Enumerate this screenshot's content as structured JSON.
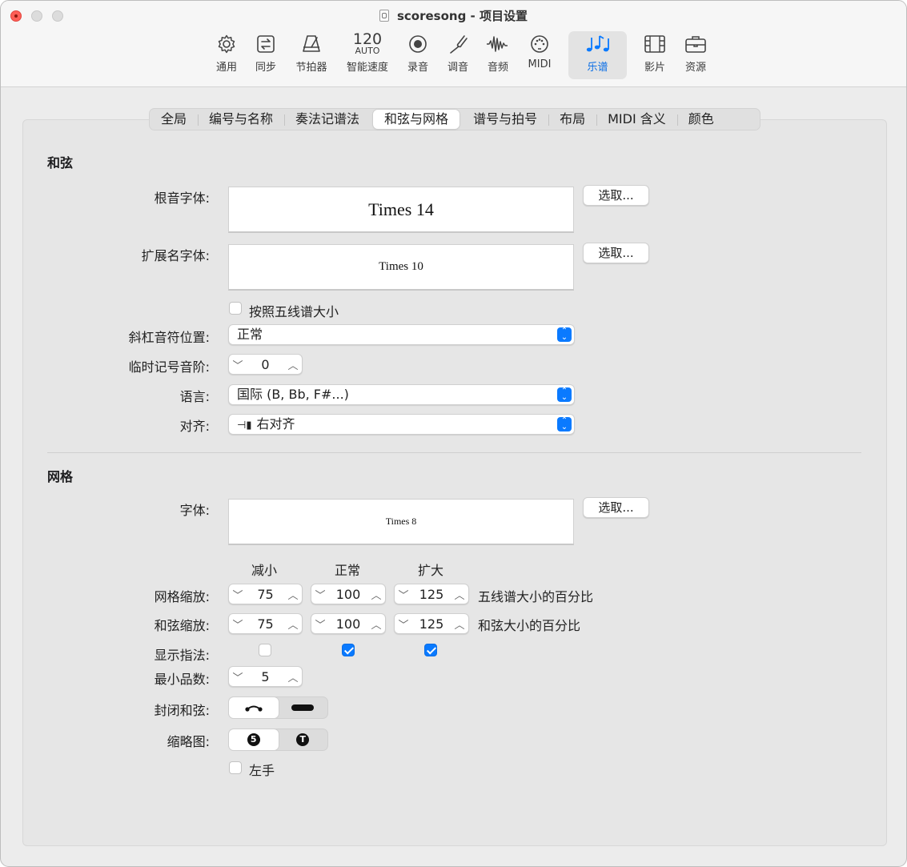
{
  "window": {
    "title": "scoresong - 项目设置"
  },
  "toolbar": {
    "items": [
      {
        "label": "通用",
        "icon": "gear-icon"
      },
      {
        "label": "同步",
        "icon": "sync-icon"
      },
      {
        "label": "节拍器",
        "icon": "metronome-icon"
      },
      {
        "label": "智能速度",
        "icon": "tempo-icon",
        "bpm": "120",
        "auto": "AUTO"
      },
      {
        "label": "录音",
        "icon": "record-icon"
      },
      {
        "label": "调音",
        "icon": "tuning-fork-icon"
      },
      {
        "label": "音频",
        "icon": "waveform-icon"
      },
      {
        "label": "MIDI",
        "icon": "midi-port-icon"
      },
      {
        "label": "乐谱",
        "icon": "score-notes-icon",
        "active": true
      },
      {
        "label": "影片",
        "icon": "film-icon"
      },
      {
        "label": "资源",
        "icon": "briefcase-icon"
      }
    ],
    "accent_color": "#0a6ee6"
  },
  "tabs": [
    {
      "label": "全局"
    },
    {
      "label": "编号与名称"
    },
    {
      "label": "奏法记谱法"
    },
    {
      "label": "和弦与网格",
      "active": true
    },
    {
      "label": "谱号与拍号"
    },
    {
      "label": "布局"
    },
    {
      "label": "MIDI 含义"
    },
    {
      "label": "颜色"
    }
  ],
  "chords": {
    "section_title": "和弦",
    "root_font_label": "根音字体:",
    "root_font_value": "Times 14",
    "ext_font_label": "扩展名字体:",
    "ext_font_value": "Times 10",
    "choose_label": "选取...",
    "staff_size_label": "按照五线谱大小",
    "staff_size_checked": false,
    "slash_label": "斜杠音符位置:",
    "slash_value": "正常",
    "accidental_label": "临时记号音阶:",
    "accidental_value": "0",
    "language_label": "语言:",
    "language_value": "国际 (B, Bb, F#...)",
    "align_label": "对齐:",
    "align_value": "右对齐"
  },
  "grid": {
    "section_title": "网格",
    "font_label": "字体:",
    "font_value": "Times 8",
    "choose_label": "选取...",
    "col_reduced": "减小",
    "col_normal": "正常",
    "col_enlarged": "扩大",
    "grid_scale_label": "网格缩放:",
    "grid_scale": [
      "75",
      "100",
      "125"
    ],
    "grid_scale_suffix": "五线谱大小的百分比",
    "chord_scale_label": "和弦缩放:",
    "chord_scale": [
      "75",
      "100",
      "125"
    ],
    "chord_scale_suffix": "和弦大小的百分比",
    "fingering_label": "显示指法:",
    "fingering": [
      false,
      true,
      true
    ],
    "min_frets_label": "最小品数:",
    "min_frets_value": "5",
    "barre_label": "封闭和弦:",
    "barre_options": [
      "arc-barre-icon",
      "bar-barre-icon"
    ],
    "barre_selected": 0,
    "thumb_label": "缩略图:",
    "thumb_options": [
      "5",
      "T"
    ],
    "thumb_selected": 0,
    "left_hand_label": "左手",
    "left_hand_checked": false
  }
}
